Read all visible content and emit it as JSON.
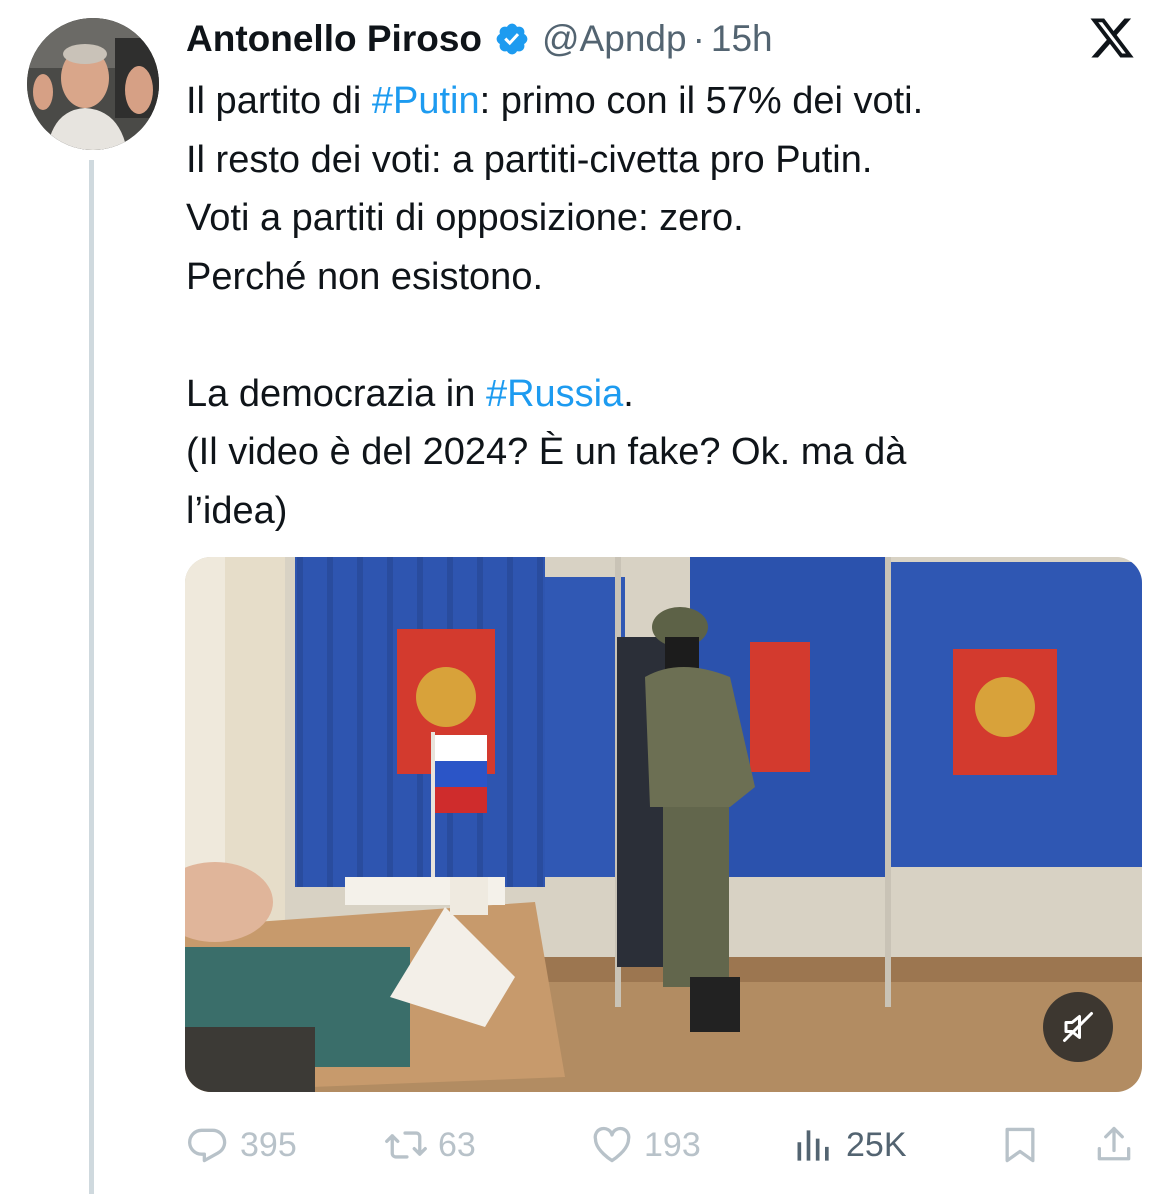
{
  "tweet": {
    "author_name": "Antonello Piroso",
    "handle": "@Apndp",
    "separator": "·",
    "time": "15h",
    "text_lines": [
      [
        {
          "t": "Il partito di "
        },
        {
          "t": "#Putin",
          "tag": true
        },
        {
          "t": ": primo con il 57% dei voti."
        }
      ],
      [
        {
          "t": "Il resto dei voti: a partiti-civetta pro Putin."
        }
      ],
      [
        {
          "t": "Voti a partiti di opposizione: zero."
        }
      ],
      [
        {
          "t": "Perché non esistono."
        }
      ],
      [],
      [
        {
          "t": "La democrazia in "
        },
        {
          "t": "#Russia",
          "tag": true
        },
        {
          "t": "."
        }
      ],
      [
        {
          "t": "(Il video è del 2024? È un fake? Ok. ma dà"
        }
      ],
      [
        {
          "t": "l’idea)"
        }
      ]
    ],
    "media": {
      "type": "video",
      "muted": true,
      "control_icon": "muted-speaker-icon"
    },
    "actions": {
      "replies": "395",
      "reposts": "63",
      "likes": "193",
      "views": "25K"
    }
  },
  "icons": {
    "verified": "verified-badge-icon",
    "platform": "x-logo-icon",
    "reply": "reply-icon",
    "repost": "repost-icon",
    "like": "heart-icon",
    "views": "views-chart-icon",
    "bookmark": "bookmark-icon",
    "share": "share-icon"
  },
  "colors": {
    "accent": "#1d9bf0",
    "text": "#0f1419",
    "secondary": "#536471",
    "muted_icons": "#b8c2c9",
    "thread_line": "#cfd9de"
  }
}
